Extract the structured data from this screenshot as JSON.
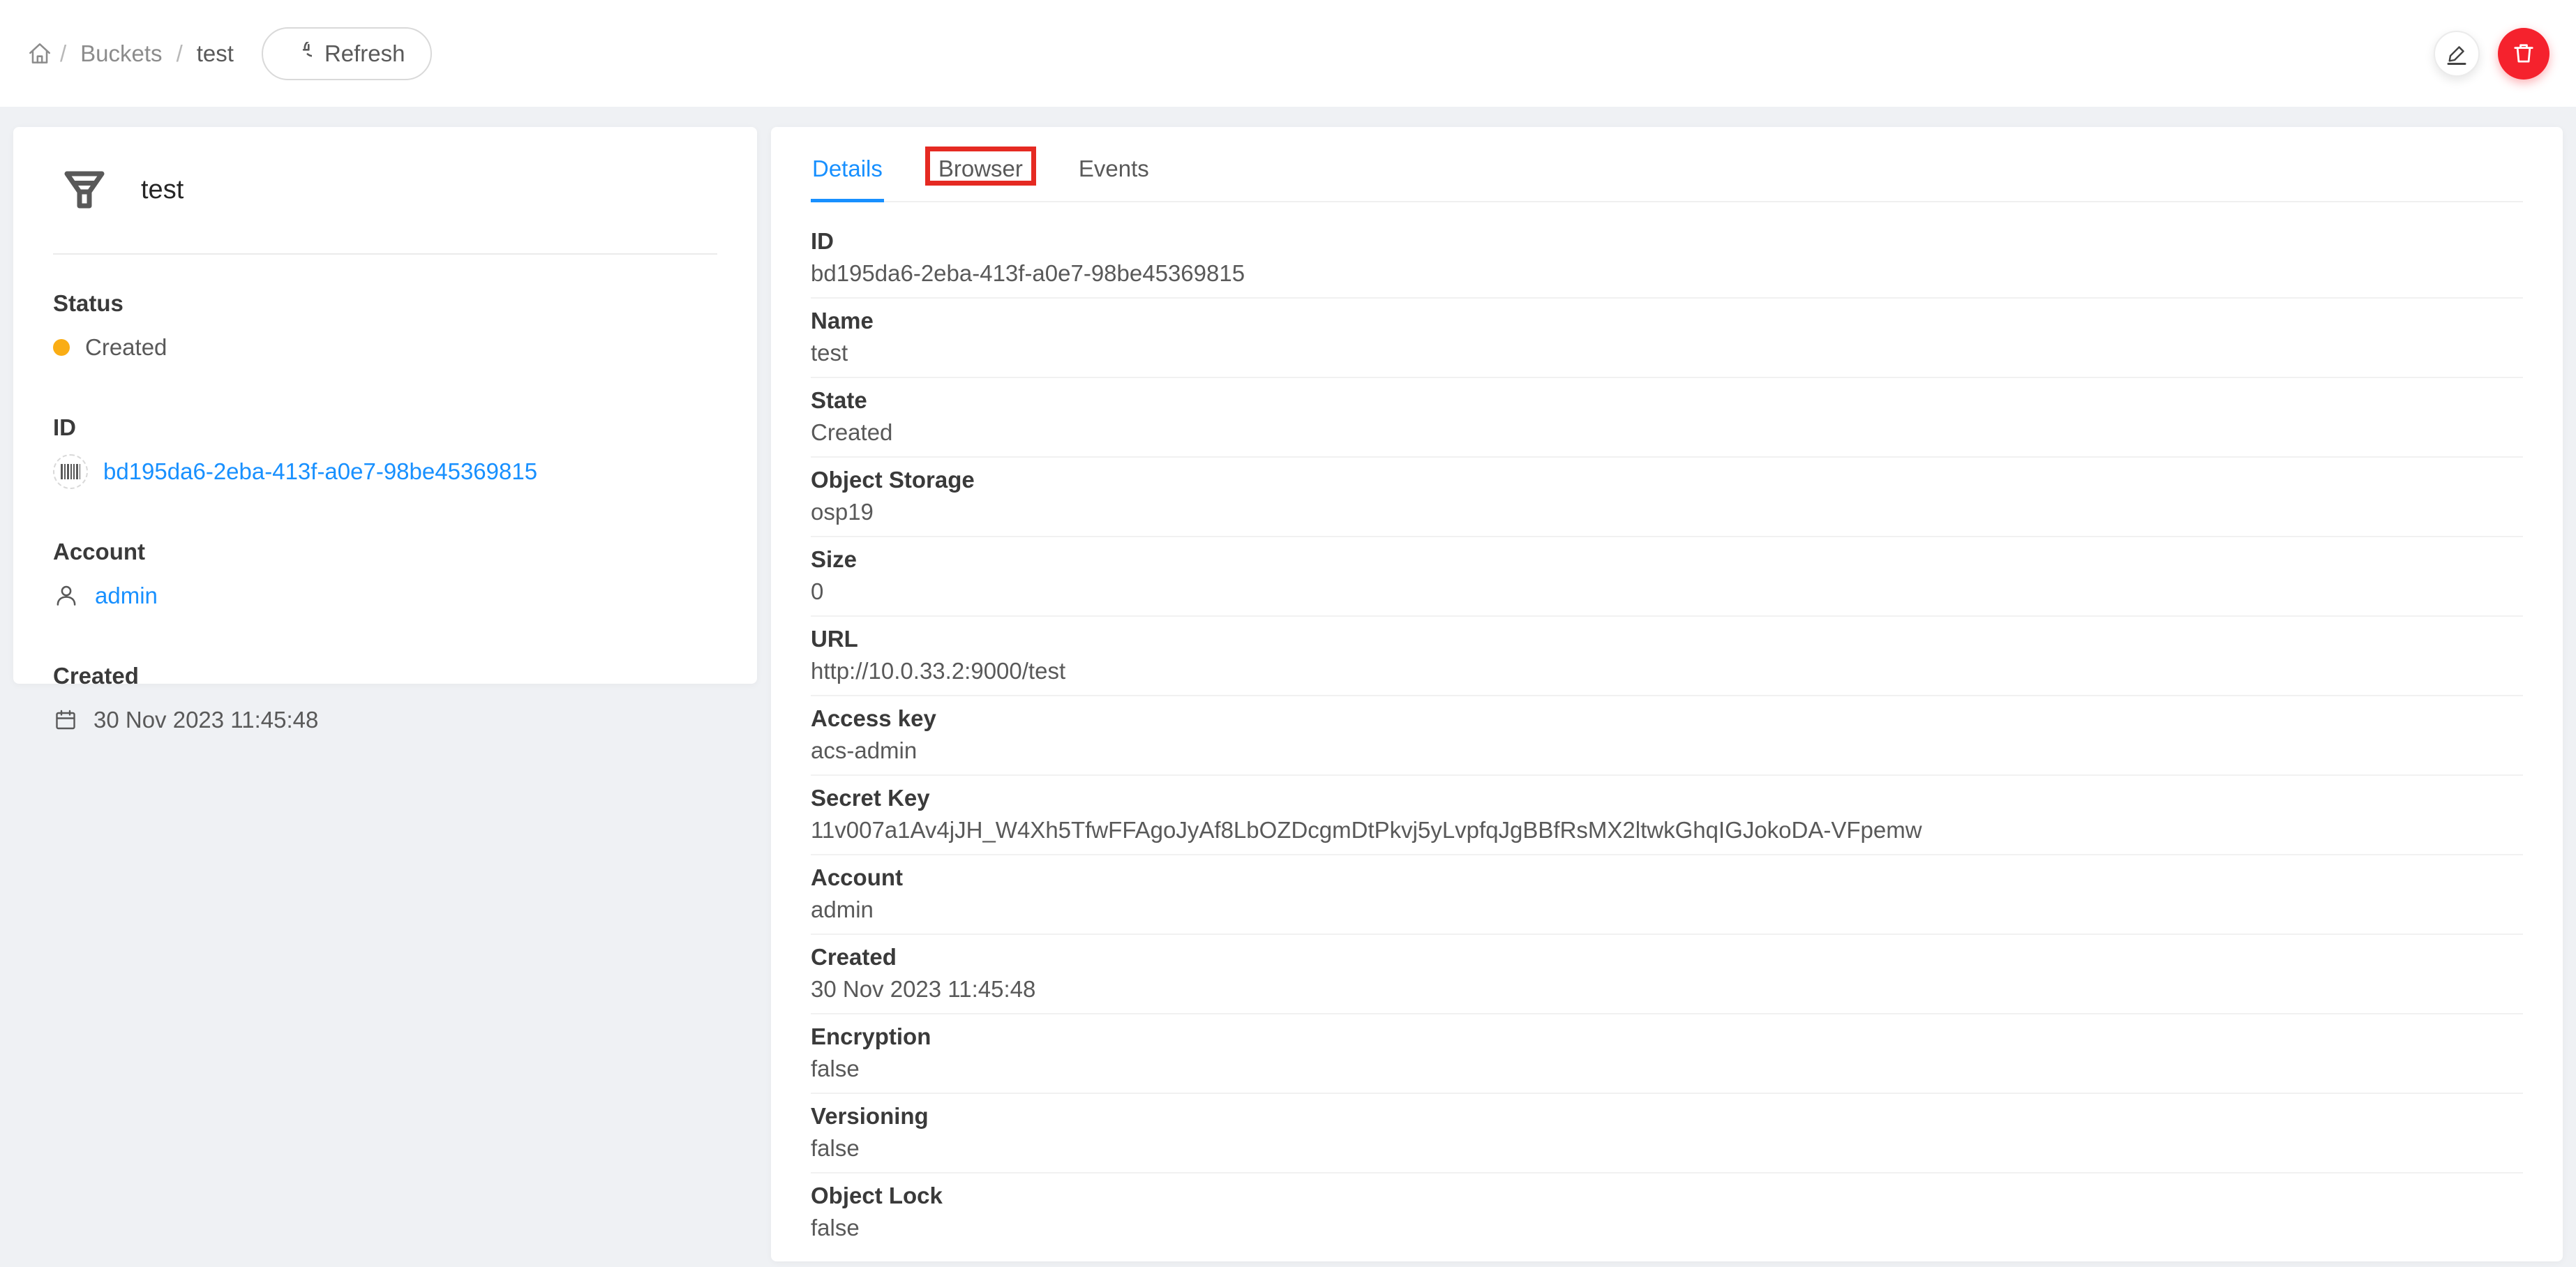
{
  "breadcrumb": {
    "separator": "/",
    "items": [
      {
        "label": "Buckets"
      },
      {
        "label": "test"
      }
    ]
  },
  "toolbar": {
    "refresh_label": "Refresh"
  },
  "colors": {
    "accent": "#1890ff",
    "danger": "#f5222d",
    "status_created": "#faad14",
    "annotation": "#e52a22"
  },
  "resource_card": {
    "title": "test",
    "fields": {
      "status": {
        "label": "Status",
        "value": "Created"
      },
      "id": {
        "label": "ID",
        "value": "bd195da6-2eba-413f-a0e7-98be45369815"
      },
      "account": {
        "label": "Account",
        "value": "admin"
      },
      "created": {
        "label": "Created",
        "value": "30 Nov 2023 11:45:48"
      }
    }
  },
  "tabs": [
    {
      "label": "Details"
    },
    {
      "label": "Browser"
    },
    {
      "label": "Events"
    }
  ],
  "details": {
    "rows": [
      {
        "label": "ID",
        "value": "bd195da6-2eba-413f-a0e7-98be45369815"
      },
      {
        "label": "Name",
        "value": "test"
      },
      {
        "label": "State",
        "value": "Created"
      },
      {
        "label": "Object Storage",
        "value": "osp19"
      },
      {
        "label": "Size",
        "value": "0"
      },
      {
        "label": "URL",
        "value": "http://10.0.33.2:9000/test"
      },
      {
        "label": "Access key",
        "value": "acs-admin"
      },
      {
        "label": "Secret Key",
        "value": "11v007a1Av4jJH_W4Xh5TfwFFAgoJyAf8LbOZDcgmDtPkvj5yLvpfqJgBBfRsMX2ltwkGhqIGJokoDA-VFpemw"
      },
      {
        "label": "Account",
        "value": "admin"
      },
      {
        "label": "Created",
        "value": "30 Nov 2023 11:45:48"
      },
      {
        "label": "Encryption",
        "value": "false"
      },
      {
        "label": "Versioning",
        "value": "false"
      },
      {
        "label": "Object Lock",
        "value": "false"
      }
    ]
  }
}
